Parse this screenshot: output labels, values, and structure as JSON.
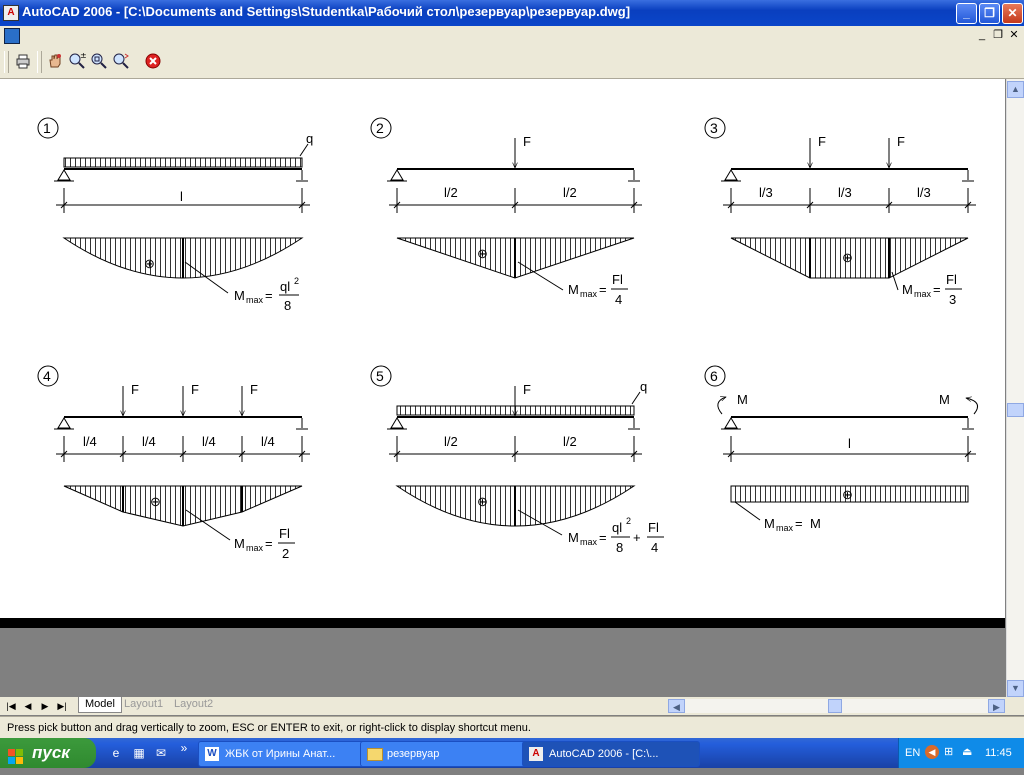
{
  "window": {
    "title": "AutoCAD 2006 - [C:\\Documents and Settings\\Studentka\\Рабочий стол\\резервуар\\резервуар.dwg]",
    "minimize": "_",
    "maximize": "❐",
    "close": "✕"
  },
  "mdi": {
    "minimize": "_",
    "restore": "❐",
    "close": "✕"
  },
  "toolbar": {
    "items": [
      {
        "name": "print-preview-icon",
        "glyph": "⎙"
      },
      {
        "name": "pan-icon",
        "glyph": "✋"
      },
      {
        "name": "zoom-realtime-icon",
        "glyph": "🔍"
      },
      {
        "name": "zoom-window-icon",
        "glyph": "🔎"
      },
      {
        "name": "zoom-previous-icon",
        "glyph": "🔍"
      },
      {
        "name": "close-preview-icon",
        "glyph": "✖"
      }
    ]
  },
  "diagrams": {
    "d1": {
      "num": "1",
      "q": "q",
      "l": "l",
      "mmax": "M",
      "sub": "max",
      "eq": "=",
      "num_top": "ql",
      "exp": "2",
      "den": "8",
      "plus": "⊕"
    },
    "d2": {
      "num": "2",
      "f": "F",
      "l1": "l/2",
      "l2": "l/2",
      "mmax": "M",
      "sub": "max",
      "eq": "=",
      "num_top": "Fl",
      "den": "4",
      "plus": "⊕"
    },
    "d3": {
      "num": "3",
      "f1": "F",
      "f2": "F",
      "l1": "l/3",
      "l2": "l/3",
      "l3": "l/3",
      "mmax": "M",
      "sub": "max",
      "eq": "=",
      "num_top": "Fl",
      "den": "3",
      "plus": "⊕"
    },
    "d4": {
      "num": "4",
      "f1": "F",
      "f2": "F",
      "f3": "F",
      "l1": "l/4",
      "l2": "l/4",
      "l3": "l/4",
      "l4": "l/4",
      "mmax": "M",
      "sub": "max",
      "eq": "=",
      "num_top": "Fl",
      "den": "2",
      "plus": "⊕"
    },
    "d5": {
      "num": "5",
      "f": "F",
      "q": "q",
      "l1": "l/2",
      "l2": "l/2",
      "mmax": "M",
      "sub": "max",
      "eq": "=",
      "num_top": "ql",
      "exp": "2",
      "den": "8",
      "plus_sign": "+",
      "num_top2": "Fl",
      "den2": "4",
      "plus": "⊕"
    },
    "d6": {
      "num": "6",
      "m1": "M",
      "m2": "M",
      "l": "l",
      "mmax": "M",
      "sub": "max",
      "eq": "=",
      "rhs": "M",
      "plus": "⊕"
    }
  },
  "tabs": {
    "nav": [
      "|◀",
      "◀",
      "▶",
      "▶|"
    ],
    "items": [
      {
        "label": "Model",
        "active": true
      },
      {
        "label": "Layout1",
        "active": false
      },
      {
        "label": "Layout2",
        "active": false
      }
    ]
  },
  "command_line": {
    "text": "Press pick button and drag vertically to zoom, ESC or ENTER to exit, or right-click to display shortcut menu."
  },
  "taskbar": {
    "start": "пуск",
    "tasks": [
      {
        "label": "ЖБК от Ирины Анат...",
        "icon": "word-icon"
      },
      {
        "label": "резервуар",
        "icon": "folder-icon"
      },
      {
        "label": "AutoCAD 2006 - [C:\\...",
        "icon": "autocad-icon",
        "active": true
      }
    ],
    "chevron": "»",
    "lang": "EN",
    "time": "11:45"
  }
}
